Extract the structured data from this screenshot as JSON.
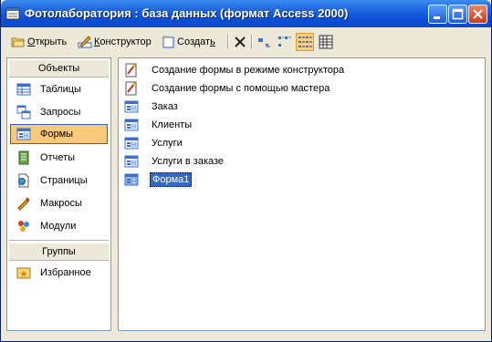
{
  "window": {
    "title": "Фотолаборатория : база данных (формат Access 2000)"
  },
  "toolbar": {
    "open_label": "ткрыть",
    "open_key": "О",
    "design_label": "онструктор",
    "design_key": "К",
    "create_label": "Создат",
    "create_key": "ь"
  },
  "objects_panel": {
    "header": "Объекты",
    "items": [
      {
        "label": "Таблицы",
        "icon": "table-icon"
      },
      {
        "label": "Запросы",
        "icon": "query-icon"
      },
      {
        "label": "Формы",
        "icon": "form-icon",
        "selected": true
      },
      {
        "label": "Отчеты",
        "icon": "report-icon"
      },
      {
        "label": "Страницы",
        "icon": "page-icon"
      },
      {
        "label": "Макросы",
        "icon": "macro-icon"
      },
      {
        "label": "Модули",
        "icon": "module-icon"
      }
    ],
    "groups_header": "Группы",
    "groups": [
      {
        "label": "Избранное",
        "icon": "favorites-icon"
      }
    ]
  },
  "list": {
    "items": [
      {
        "label": "Создание формы в режиме конструктора",
        "icon": "wizard-icon"
      },
      {
        "label": "Создание формы с помощью мастера",
        "icon": "wizard-icon"
      },
      {
        "label": "Заказ",
        "icon": "form-icon"
      },
      {
        "label": "Клиенты",
        "icon": "form-icon"
      },
      {
        "label": "Услуги",
        "icon": "form-icon"
      },
      {
        "label": "Услуги в заказе",
        "icon": "form-icon"
      },
      {
        "label": "Форма1",
        "icon": "form-icon",
        "selected": true
      }
    ]
  }
}
